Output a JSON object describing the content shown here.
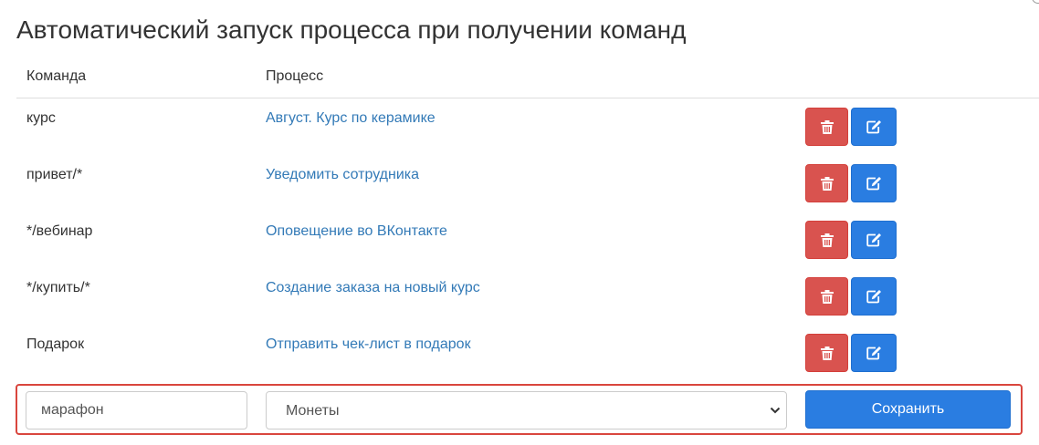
{
  "page": {
    "title": "Автоматический запуск процесса при получении команд"
  },
  "table": {
    "columns": {
      "command": "Команда",
      "process": "Процесс"
    },
    "rows": [
      {
        "command": "курс",
        "process": "Август. Курс по керамике"
      },
      {
        "command": "привет/*",
        "process": "Уведомить сотрудника"
      },
      {
        "command": "*/вебинар",
        "process": "Оповещение во ВКонтакте"
      },
      {
        "command": "*/купить/*",
        "process": "Создание заказа на новый курс"
      },
      {
        "command": "Подарок",
        "process": "Отправить чек-лист в подарок"
      }
    ],
    "row_actions": {
      "delete_icon": "trash-icon",
      "edit_icon": "edit-icon"
    }
  },
  "new_entry": {
    "command_value": "марафон",
    "process_selected": "Монеты",
    "save_label": "Сохранить"
  },
  "colors": {
    "link": "#337ab7",
    "danger": "#d9534f",
    "primary": "#2a7de1",
    "highlight_border": "#d9463e"
  }
}
